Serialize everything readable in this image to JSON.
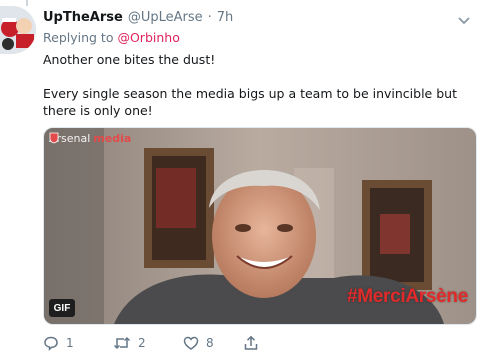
{
  "tweet": {
    "display_name": "UpTheArse",
    "handle": "@UpLeArse",
    "separator": "·",
    "time": "7h",
    "replying_prefix": "Replying to",
    "replying_to": "@Orbinho",
    "text_line1": "Another one bites the dust!",
    "text_line2": "Every single season the media bigs up a team to be invincible but there is only one!"
  },
  "media": {
    "brand_prefix": "Arsenal",
    "brand_suffix": "media",
    "gif_badge": "GIF",
    "hashtag": "#MerciArsène"
  },
  "actions": {
    "reply_count": "1",
    "retweet_count": "2",
    "like_count": "8"
  },
  "colors": {
    "mention": "#e0245e",
    "secondary_text": "#657786",
    "hashtag": "#e12a2a"
  },
  "icons": {
    "avatar": "avatar-image",
    "menu": "chevron-down-icon",
    "reply": "reply-icon",
    "retweet": "retweet-icon",
    "like": "heart-icon",
    "share": "share-icon"
  }
}
